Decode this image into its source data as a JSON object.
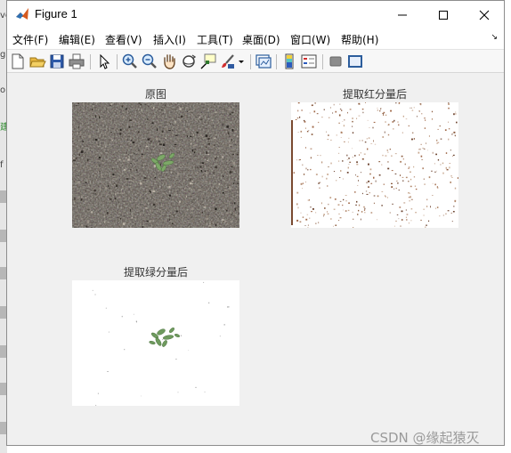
{
  "window": {
    "title": "Figure 1",
    "controls": [
      "minimize",
      "maximize",
      "close"
    ]
  },
  "menu": {
    "items": [
      "文件(F)",
      "编辑(E)",
      "查看(V)",
      "插入(I)",
      "工具(T)",
      "桌面(D)",
      "窗口(W)",
      "帮助(H)"
    ]
  },
  "toolbar": {
    "icons": [
      "new-figure-icon",
      "open-file-icon",
      "save-icon",
      "print-icon",
      "edit-plot-arrow-icon",
      "zoom-in-icon",
      "zoom-out-icon",
      "pan-hand-icon",
      "rotate-3d-icon",
      "data-cursor-icon",
      "brush-icon",
      "brush-dropdown-icon",
      "link-plot-icon",
      "insert-colorbar-icon",
      "insert-legend-icon",
      "hide-plot-tools-icon",
      "show-plot-tools-icon"
    ]
  },
  "subplots": [
    {
      "title": "原图",
      "content": "soil photo with small green seedling"
    },
    {
      "title": "提取红分量后",
      "content": "white background with scattered brown specks"
    },
    {
      "title": "提取绿分量后",
      "content": "white background with green seedling shape"
    }
  ],
  "watermark": "CSDN @缘起猿灭",
  "colors": {
    "figure_bg": "#f0f0f0",
    "soil": "#5a544c",
    "seedling": "#6e9a5e",
    "speck": "#8a5a3c"
  }
}
